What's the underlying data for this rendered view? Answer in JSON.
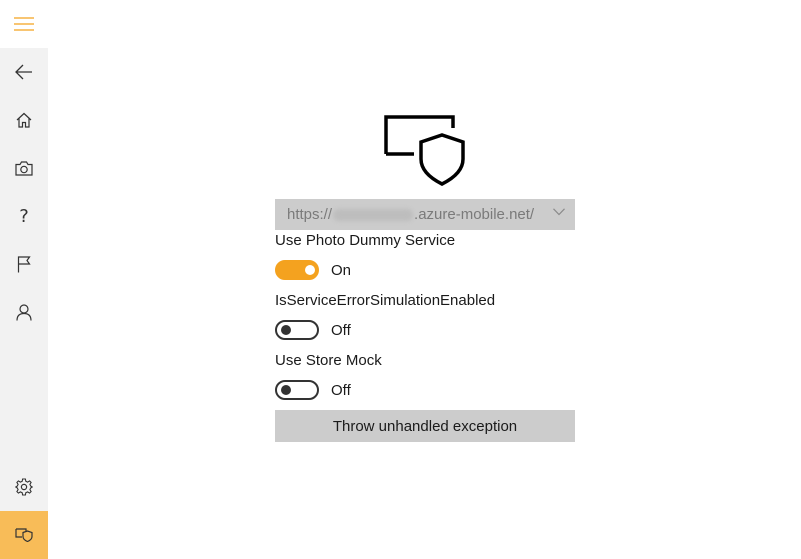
{
  "nav": {
    "items": [
      {
        "name": "back-icon"
      },
      {
        "name": "home-icon"
      },
      {
        "name": "camera-icon"
      },
      {
        "name": "help-icon",
        "glyph": "?"
      },
      {
        "name": "flag-icon"
      },
      {
        "name": "person-icon"
      },
      {
        "name": "settings-icon"
      },
      {
        "name": "debug-shield-icon",
        "active": true
      }
    ],
    "accent": "#f8bc58",
    "hamburger_color": "#f4a21f"
  },
  "service_url": {
    "prefix": "https://",
    "suffix": ".azure-mobile.net/"
  },
  "settings": [
    {
      "label": "Use Photo Dummy Service",
      "state": "On",
      "on": true
    },
    {
      "label": "IsServiceErrorSimulationEnabled",
      "state": "Off",
      "on": false
    },
    {
      "label": "Use Store Mock",
      "state": "Off",
      "on": false
    }
  ],
  "action": {
    "label": "Throw unhandled exception"
  },
  "colors": {
    "toggle_on": "#f4a21f",
    "button_bg": "#cccccc"
  }
}
